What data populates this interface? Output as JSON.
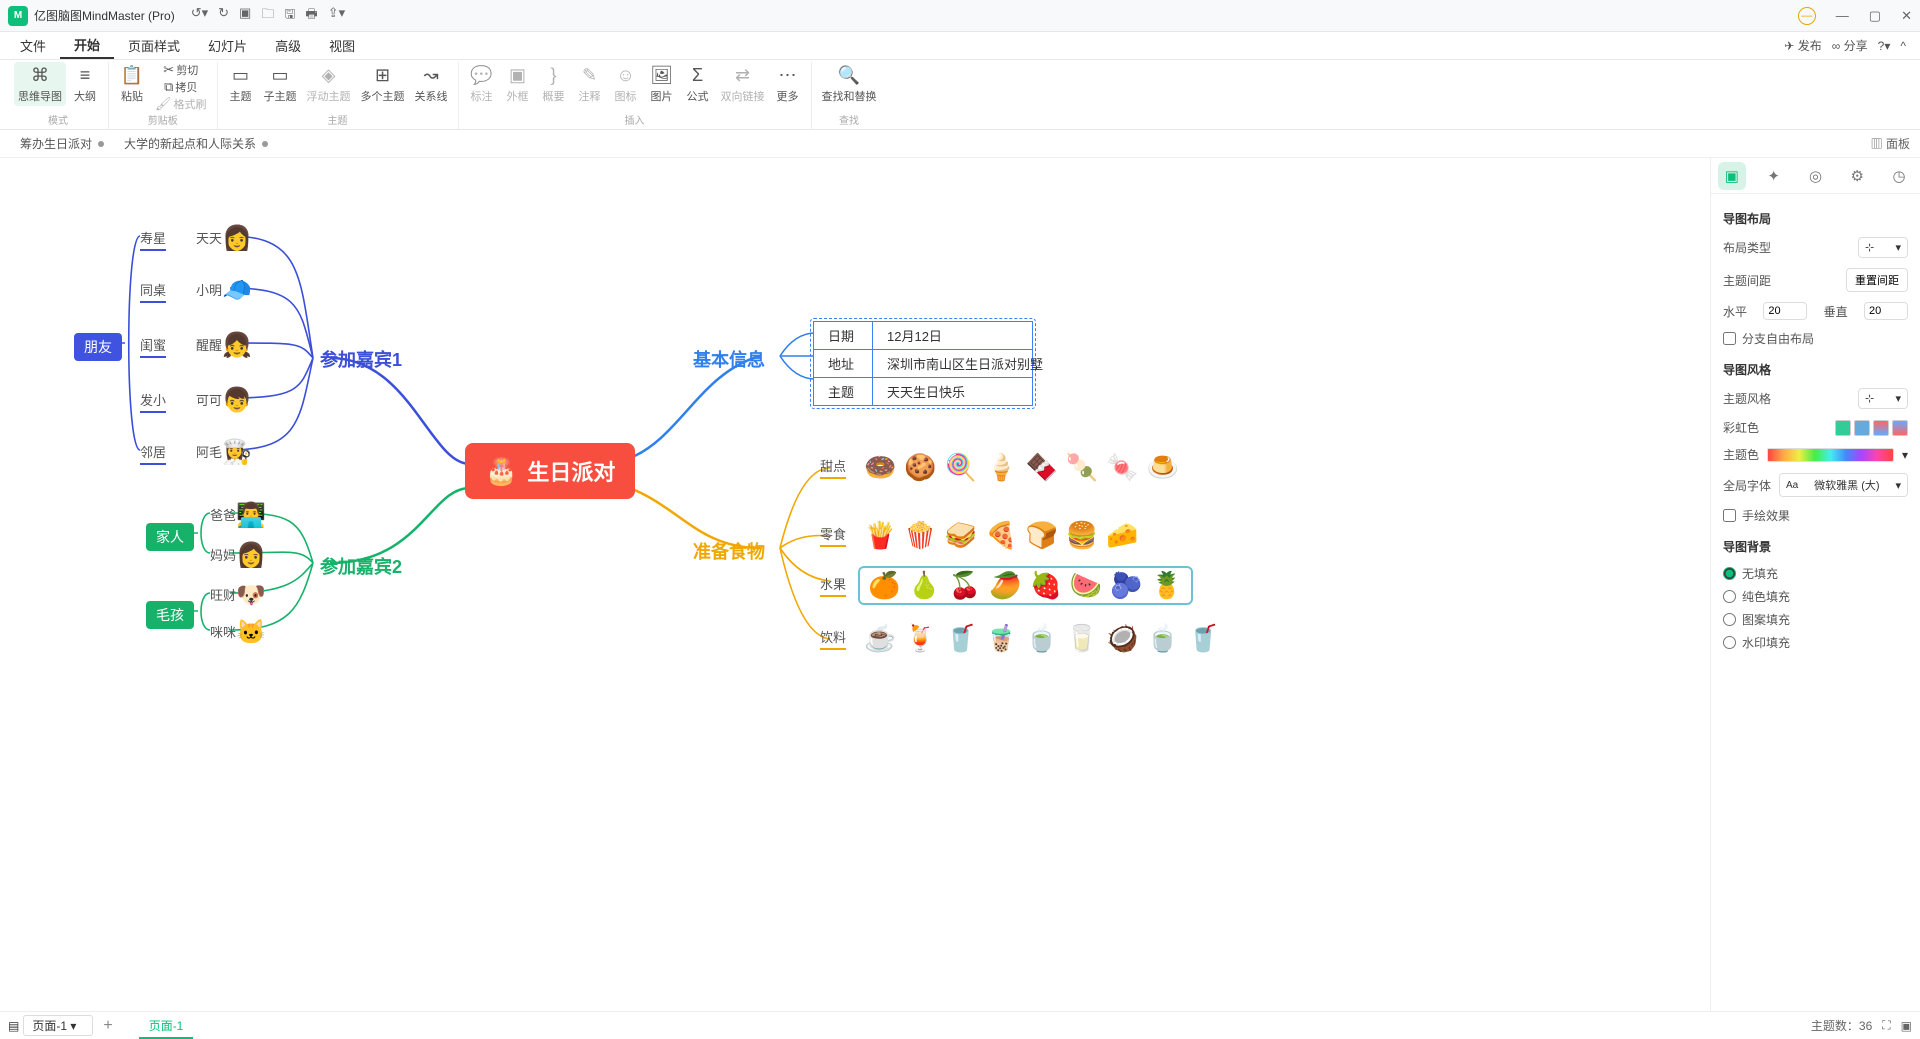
{
  "app": {
    "title": "亿图脑图MindMaster (Pro)"
  },
  "menubar": {
    "tabs": [
      "文件",
      "开始",
      "页面样式",
      "幻灯片",
      "高级",
      "视图"
    ],
    "active_index": 1,
    "publish": "发布",
    "share": "分享"
  },
  "ribbon": {
    "mode": {
      "mindmap": "思维导图",
      "outline": "大纲",
      "label": "模式"
    },
    "clipboard": {
      "paste": "粘贴",
      "cut": "剪切",
      "copy": "拷贝",
      "formatpainter": "格式刷",
      "label": "剪贴板"
    },
    "topic": {
      "topic": "主题",
      "subtopic": "子主题",
      "floating": "浮动主题",
      "multi": "多个主题",
      "relation": "关系线",
      "label": "主题"
    },
    "insert": {
      "callout": "标注",
      "boundary": "外框",
      "summary": "概要",
      "note": "注释",
      "icon": "图标",
      "image": "图片",
      "formula": "公式",
      "hyperlink": "双向链接",
      "more": "更多",
      "label": "插入"
    },
    "find": {
      "findreplace": "查找和替换",
      "label": "查找"
    }
  },
  "doctabs": {
    "tab1": "筹办生日派对",
    "tab2": "大学的新起点和人际关系",
    "panel": "面板"
  },
  "mindmap": {
    "center": "生日派对",
    "branch_guests1": "参加嘉宾1",
    "branch_guests2": "参加嘉宾2",
    "branch_info": "基本信息",
    "branch_food": "准备食物",
    "tag_friends": "朋友",
    "tag_family": "家人",
    "tag_pet": "毛孩",
    "friends": [
      {
        "rel": "寿星",
        "name": "天天"
      },
      {
        "rel": "同桌",
        "name": "小明"
      },
      {
        "rel": "闺蜜",
        "name": "醒醒"
      },
      {
        "rel": "发小",
        "name": "可可"
      },
      {
        "rel": "邻居",
        "name": "阿毛"
      }
    ],
    "family": [
      {
        "name": "爸爸"
      },
      {
        "name": "妈妈"
      }
    ],
    "pets": [
      {
        "name": "旺财"
      },
      {
        "name": "咪咪"
      }
    ],
    "info": {
      "date_k": "日期",
      "date_v": "12月12日",
      "addr_k": "地址",
      "addr_v": "深圳市南山区生日派对别墅",
      "theme_k": "主题",
      "theme_v": "天天生日快乐"
    },
    "food": {
      "dessert": "甜点",
      "snack": "零食",
      "fruit": "水果",
      "drink": "饮料"
    }
  },
  "rightpanel": {
    "sec_layout": "导图布局",
    "layout_type": "布局类型",
    "spacing": "主题间距",
    "reset_spacing": "重置间距",
    "h": "水平",
    "h_val": "20",
    "v": "垂直",
    "v_val": "20",
    "branch_free": "分支自由布局",
    "sec_style": "导图风格",
    "theme_style": "主题风格",
    "rainbow": "彩虹色",
    "theme_color": "主题色",
    "global_font": "全局字体",
    "font_val": "微软雅黑 (大)",
    "hand": "手绘效果",
    "sec_bg": "导图背景",
    "bg_none": "无填充",
    "bg_solid": "纯色填充",
    "bg_pattern": "图案填充",
    "bg_watermark": "水印填充"
  },
  "statusbar": {
    "page_sel": "页面-1",
    "page_tab": "页面-1",
    "topic_count_label": "主题数：",
    "topic_count": "36"
  }
}
